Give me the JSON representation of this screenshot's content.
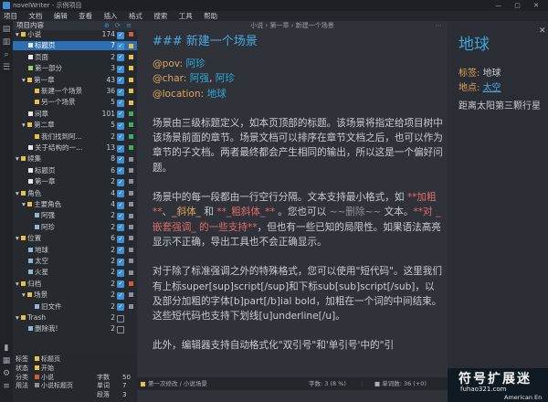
{
  "window": {
    "title": "novelWriter - 示例项目",
    "controls": "— ▢ ✕"
  },
  "menu": [
    "项目",
    "文档",
    "编辑",
    "查看",
    "插入",
    "格式",
    "搜索",
    "工具",
    "帮助"
  ],
  "tree": {
    "header": "项目内容",
    "tools": "⊕ ⟳ ≡",
    "rows": [
      {
        "label": "小说",
        "count": "174",
        "indent": 0,
        "type": "root",
        "expand": "▾",
        "checked": true,
        "dot": "#d9583a"
      },
      {
        "label": "标题页",
        "count": "7",
        "indent": 2,
        "type": "doc",
        "checked": true,
        "dot": "#e3c14b",
        "selected": true
      },
      {
        "label": "页面",
        "count": "2",
        "indent": 2,
        "type": "doc",
        "checked": true,
        "dot": "#e3c14b"
      },
      {
        "label": "第一部分",
        "count": "3",
        "indent": 2,
        "type": "part",
        "checked": true,
        "dot": "#e3c14b"
      },
      {
        "label": "第一章",
        "count": "43",
        "indent": 1,
        "type": "chapter",
        "expand": "▾",
        "checked": true,
        "dot": "#e3c14b"
      },
      {
        "label": "新建一个场景",
        "count": "36",
        "indent": 3,
        "type": "scene",
        "checked": true,
        "dot": "#e3c14b"
      },
      {
        "label": "另一个场景",
        "count": "5",
        "indent": 3,
        "type": "scene",
        "checked": true,
        "dot": "#e3c14b"
      },
      {
        "label": "间章",
        "count": "101",
        "indent": 2,
        "type": "doc",
        "checked": true,
        "dot": "#3fae5a"
      },
      {
        "label": "第二章",
        "count": "5",
        "indent": 1,
        "type": "chapter",
        "expand": "▾",
        "checked": true,
        "dot": "#3fae5a"
      },
      {
        "label": "我们找到阿…",
        "count": "2",
        "indent": 3,
        "type": "scene",
        "checked": true,
        "dot": "#3fae5a"
      },
      {
        "label": "关于结构的一…",
        "count": "13",
        "indent": 2,
        "type": "doc",
        "checked": true,
        "dot": "#3fae5a"
      },
      {
        "label": "续集",
        "count": "8",
        "indent": 0,
        "type": "root",
        "expand": "▾",
        "checked": true,
        "dot": "#8a9199"
      },
      {
        "label": "标题页",
        "count": "6",
        "indent": 2,
        "type": "doc",
        "checked": true,
        "dot": "#8a9199"
      },
      {
        "label": "第一章",
        "count": "2",
        "indent": 2,
        "type": "doc",
        "checked": true,
        "dot": "#8a9199"
      },
      {
        "label": "角色",
        "count": "4",
        "indent": 0,
        "type": "root",
        "expand": "▾",
        "checked": true,
        "dot": "#8a9199"
      },
      {
        "label": "主要角色",
        "count": "4",
        "indent": 1,
        "type": "folder",
        "expand": "▾",
        "checked": true,
        "dot": "#8a9199"
      },
      {
        "label": "阿强",
        "count": "2",
        "indent": 3,
        "type": "note",
        "checked": true,
        "dot": "#8a9199"
      },
      {
        "label": "阿珍",
        "count": "2",
        "indent": 3,
        "type": "note",
        "checked": true,
        "dot": "#8a9199"
      },
      {
        "label": "位置",
        "count": "6",
        "indent": 0,
        "type": "root",
        "expand": "▾",
        "checked": true,
        "dot": "#8a9199"
      },
      {
        "label": "地球",
        "count": "2",
        "indent": 2,
        "type": "note",
        "checked": true,
        "dot": "#8a9199"
      },
      {
        "label": "太空",
        "count": "2",
        "indent": 2,
        "type": "note",
        "checked": true,
        "dot": "#8a9199"
      },
      {
        "label": "火星",
        "count": "2",
        "indent": 2,
        "type": "note",
        "checked": true,
        "dot": "#8a9199"
      },
      {
        "label": "归档",
        "count": "2",
        "indent": 0,
        "type": "root",
        "expand": "▾",
        "checked": true,
        "dot": "#d9583a"
      },
      {
        "label": "场景",
        "count": "2",
        "indent": 1,
        "type": "folder",
        "expand": "▾",
        "checked": true,
        "dot": "#8a9199"
      },
      {
        "label": "旧文件",
        "count": "2",
        "indent": 3,
        "type": "note",
        "checked": true,
        "dot": "#8a9199"
      },
      {
        "label": "Trash",
        "count": "2",
        "indent": 0,
        "type": "root",
        "expand": "▾",
        "checked": false,
        "dot": ""
      },
      {
        "label": "删除我!",
        "count": "2",
        "indent": 2,
        "type": "note",
        "checked": false,
        "dot": ""
      }
    ]
  },
  "info": {
    "rows": [
      {
        "k": "标签",
        "v": "标题页",
        "mark": "#e3c14b",
        "k2": "",
        "v2": ""
      },
      {
        "k": "状态",
        "v": "开始",
        "mark": "#e3c14b",
        "k2": "",
        "v2": ""
      },
      {
        "k": "分类",
        "v": "小说",
        "mark": "#d9583a",
        "k2": "字数",
        "v2": "50"
      },
      {
        "k": "用法",
        "v": "小说标题页",
        "mark": "#8a9199",
        "k2": "单词",
        "v2": "7"
      },
      {
        "k": "",
        "v": "",
        "mark": "",
        "k2": "段落",
        "v2": "3"
      }
    ]
  },
  "editor": {
    "breadcrumb": "小说 › 第一章 › 新建一个场景",
    "hint": "⋯",
    "heading": "### 新建一个场景",
    "meta": [
      {
        "key": "@pov:",
        "links": [
          "阿珍"
        ]
      },
      {
        "key": "@char:",
        "links": [
          "阿强",
          "阿珍"
        ]
      },
      {
        "key": "@location:",
        "links": [
          "地球"
        ]
      }
    ],
    "p1": "场景由三级标题定义，如本页顶部的标题。该场景将指定给项目树中该场景前面的章节。场景文档可以排序在章节文档之后，也可以作为章节的子文档。两者最终都会产生相同的输出，所以这是一个偏好问题。",
    "p2a": "场景中的每一段都由一行空行分隔。文本支持最小格式，如 ",
    "p2_bold": "**加粗**",
    "p2b": "、",
    "p2_ital": "_斜体_",
    "p2c": " 和 ",
    "p2_bi": "**_粗斜体_**",
    "p2d": " 。您也可以 ",
    "p2_strike": "~~删除~~",
    "p2e": " 文本。",
    "p2_nest": "**对 _嵌套强调_ 的一些支持**",
    "p2f": "，但也有一些已知的局限性。如果语法高亮显示不正确，导出工具也不会正确显示。",
    "p3": "对于除了标准强调之外的特殊格式，您可以使用\"短代码\"。这里我们有上标super[sup]script[/sup]和下标sub[sub]script[/sub]，以及部分加粗的字体[b]part[/b]ial bold，加粗在一个词的中间结束。这些短代码也支持下划线[u]underline[/u]。",
    "p4": "此外，编辑器支持自动格式化\"双引号\"和'单引号'中的\"引"
  },
  "status": {
    "left": "第一次修改 / 小说场景",
    "mid": "⋮",
    "center": "字数: 3 (8 %)",
    "right": "■ 单词数: 36 (+0)"
  },
  "viewer": {
    "title": "地球",
    "close": "✕",
    "tag_key": "标签:",
    "tag_val": "地球",
    "loc_key": "地点:",
    "loc_val": "太空",
    "desc": "距离太阳第三颗行星"
  },
  "watermark": {
    "text": "符号扩展迷",
    "url": "fuhao321.com",
    "lang": "American En"
  }
}
